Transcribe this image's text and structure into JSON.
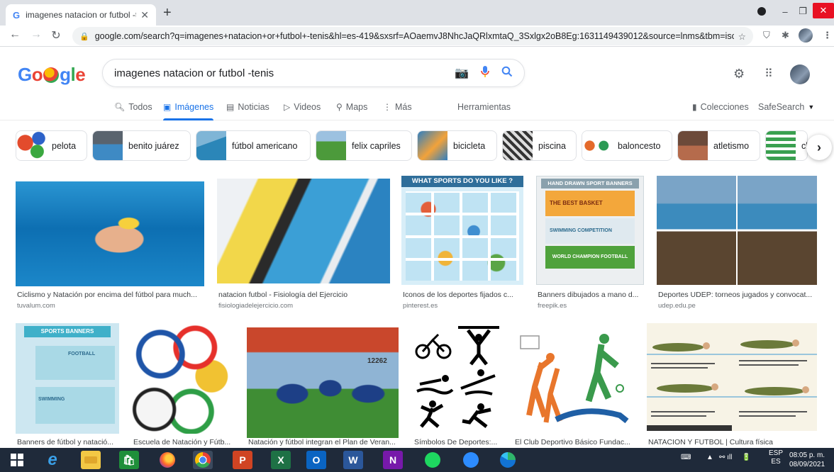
{
  "browser": {
    "tab_title": "imagenes natacion or futbol -ten",
    "tab_close": "✕",
    "new_tab": "+",
    "url": "google.com/search?q=imagenes+natacion+or+futbol+-tenis&hl=es-419&sxsrf=AOaemvJ8NhcJaQRlxmtaQ_3Sxlgx2oB8Eg:1631149439012&source=lnms&tbm=isch&s...",
    "window_minimize": "–",
    "window_maximize": "❐",
    "window_close": "✕"
  },
  "search": {
    "query": "imagenes natacion or futbol -tenis",
    "placeholder": ""
  },
  "logo": [
    "G",
    "o",
    "",
    "g",
    "l",
    "e"
  ],
  "nav_tabs": [
    {
      "label": "Todos",
      "icon": "search-icon"
    },
    {
      "label": "Imágenes",
      "icon": "image-icon"
    },
    {
      "label": "Noticias",
      "icon": "news-icon"
    },
    {
      "label": "Videos",
      "icon": "video-icon"
    },
    {
      "label": "Maps",
      "icon": "pin-icon"
    },
    {
      "label": "Más",
      "icon": "dots-icon"
    }
  ],
  "tools_label": "Herramientas",
  "collections_label": "Colecciones",
  "safesearch_label": "SafeSearch",
  "chips": [
    "pelota",
    "benito juárez",
    "fútbol americano",
    "felix capriles",
    "bicicleta",
    "piscina",
    "baloncesto",
    "atletismo",
    "cl"
  ],
  "results_row1": [
    {
      "caption": "Ciclismo y Natación por encima del fútbol para much...",
      "source": "tuvalum.com"
    },
    {
      "caption": "natacion futbol - Fisiología del Ejercicio",
      "source": "fisiologiadelejercicio.com"
    },
    {
      "caption": "Iconos de los deportes fijados c...",
      "source": "pinterest.es"
    },
    {
      "caption": "Banners dibujados a mano d...",
      "source": "freepik.es"
    },
    {
      "caption": "Deportes UDEP: torneos jugados y convocat...",
      "source": "udep.edu.pe"
    }
  ],
  "results_row2": [
    {
      "caption": "Banners de fútbol y natació..."
    },
    {
      "caption": "Escuela de Natación y Fútb..."
    },
    {
      "caption": "Natación y fútbol integran el Plan de Veran..."
    },
    {
      "caption": "Símbolos De Deportes:..."
    },
    {
      "caption": "El Club Deportivo Básico Fundac..."
    },
    {
      "caption": "NATACION Y FUTBOL | Cultura física"
    }
  ],
  "image_text": {
    "sports_question": "WHAT SPORTS DO YOU LIKE ?",
    "banner_header": "HAND DRAWN SPORT BANNERS",
    "banner_basket": "THE BEST BASKET",
    "banner_swimming": "SWIMMING COMPETITION",
    "banner_football": "WORLD CHAMPION FOOTBALL",
    "sports_banners": "SPORTS BANNERS",
    "football_label": "FOOTBALL",
    "swimming_label": "SWIMMING",
    "score_text": "12262"
  },
  "taskbar": {
    "lang_top": "ESP",
    "lang_bottom": "ES",
    "time": "08:05 p. m.",
    "date": "08/09/2021"
  },
  "colors": {
    "accent": "#1a73e8",
    "taskbar": "#1f2a3a"
  }
}
